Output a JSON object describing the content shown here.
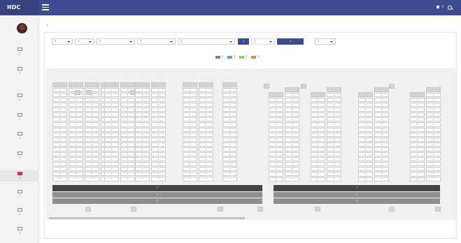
{
  "header": {
    "brand": "HDC",
    "user_label": "?"
  },
  "sidebar": {
    "items": [
      {
        "label": "?",
        "active": false
      },
      {
        "label": "?",
        "active": false
      },
      {
        "label": "?",
        "active": false
      },
      {
        "label": "?",
        "active": false
      },
      {
        "label": "?",
        "active": false
      },
      {
        "label": "?",
        "active": false
      },
      {
        "label": "?",
        "active": true
      },
      {
        "label": "?",
        "active": false
      },
      {
        "label": "?",
        "active": false
      },
      {
        "label": "?",
        "active": false
      }
    ]
  },
  "breadcrumb": "?",
  "filters": {
    "selects": [
      "?",
      "?",
      "?",
      "?",
      "?",
      "?"
    ],
    "search_button": "?",
    "input": "?",
    "apply_button": "?"
  },
  "legend": [
    {
      "label": "?",
      "color": "#6b7fa8"
    },
    {
      "label": "?",
      "color": "#5aa6c9"
    },
    {
      "label": "?",
      "color": "#8fcf6a"
    },
    {
      "label": "?",
      "color": "#e58a2e"
    }
  ],
  "buildings": [
    {
      "name": "?",
      "line1": "?",
      "line2": "?"
    },
    {
      "name": "?",
      "line1": "?",
      "line2": "?"
    }
  ],
  "unit_label": "?"
}
